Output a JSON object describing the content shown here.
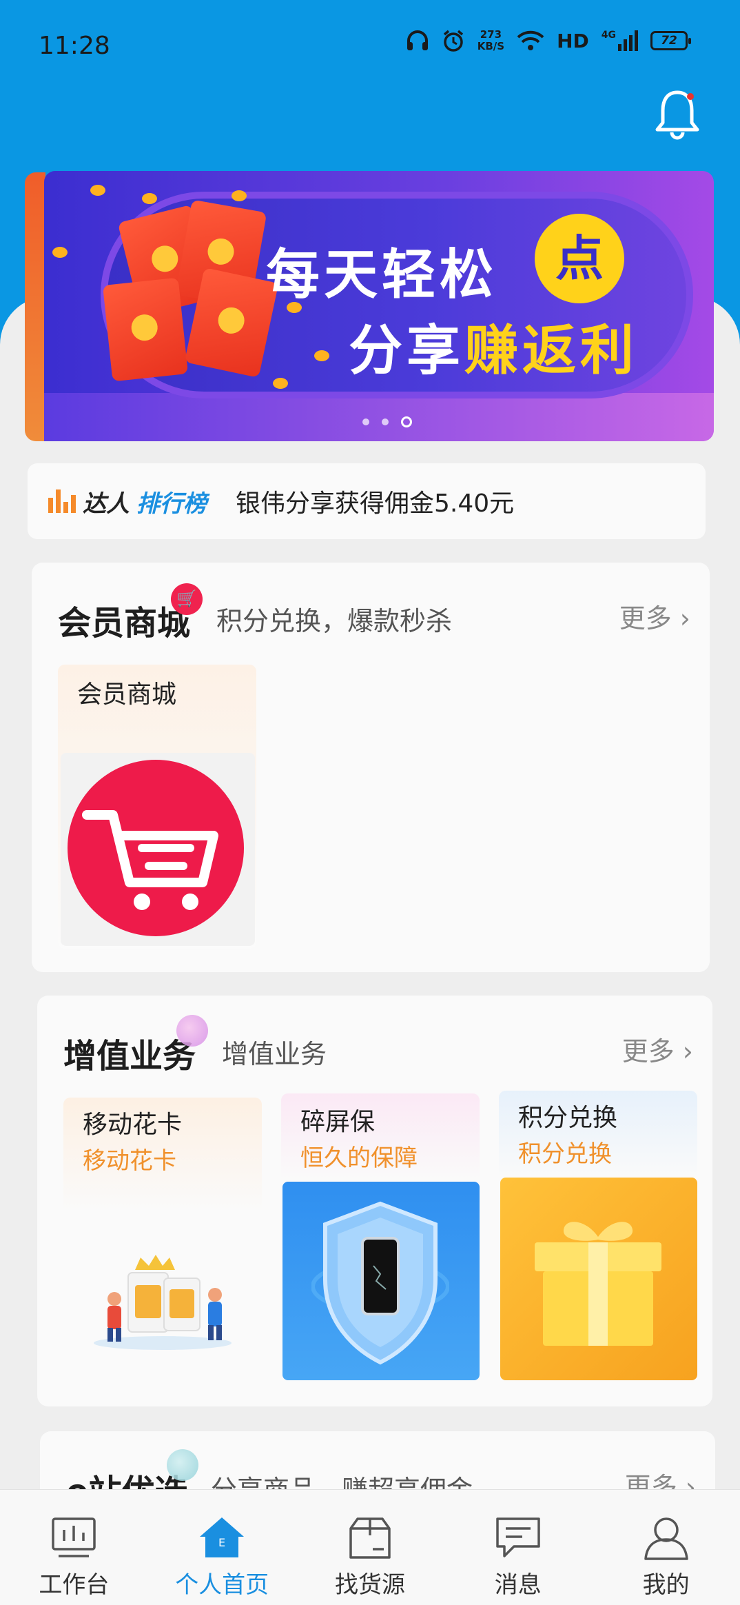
{
  "status_bar": {
    "time": "11:28",
    "net_speed_value": "273",
    "net_speed_unit": "KB/S",
    "network": "HD",
    "signal": "4G",
    "battery": "72"
  },
  "banner": {
    "line1": "每天轻松",
    "badge": "点",
    "line2_plain": "分享",
    "line2_highlight": "赚返利"
  },
  "ranking": {
    "logo_part1": "达人",
    "logo_part2": "排行榜",
    "message": "银伟分享获得佣金5.40元"
  },
  "member_mall": {
    "title": "会员商城",
    "subtitle": "积分兑换，爆款秒杀",
    "more": "更多",
    "tile_name": "会员商城"
  },
  "value_added": {
    "title": "增值业务",
    "subtitle": "增值业务",
    "more": "更多",
    "tiles": [
      {
        "name": "移动花卡",
        "sub": "移动花卡"
      },
      {
        "name": "碎屏保",
        "sub": "恒久的保障"
      },
      {
        "name": "积分兑换",
        "sub": "积分兑换"
      }
    ]
  },
  "e_station": {
    "title": "e站优选",
    "subtitle": "分享商品，赚超高佣金",
    "more": "更多"
  },
  "bottom_nav": [
    {
      "label": "工作台",
      "icon": "workbench-icon"
    },
    {
      "label": "个人首页",
      "icon": "home-icon"
    },
    {
      "label": "找货源",
      "icon": "box-icon"
    },
    {
      "label": "消息",
      "icon": "message-icon"
    },
    {
      "label": "我的",
      "icon": "profile-icon"
    }
  ],
  "colors": {
    "header_blue": "#0a97e3",
    "active_blue": "#1a8fe0",
    "accent_orange": "#f0912c",
    "cart_red": "#ee1b4a"
  }
}
